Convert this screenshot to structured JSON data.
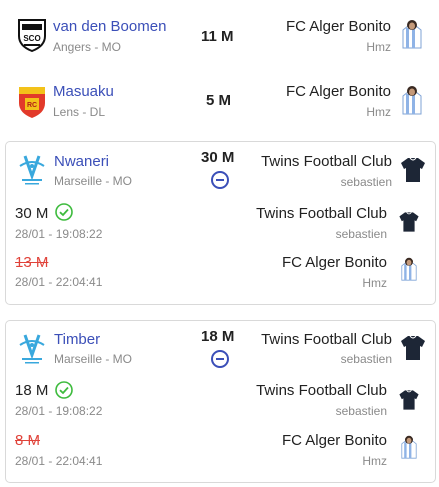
{
  "transfers": [
    {
      "player": "van den Boomen",
      "club_position": "Angers - MO",
      "club_logo": "angers-sco-logo",
      "price": "11 M",
      "team": "FC Alger Bonito",
      "manager": "Hmz",
      "avatar": "striped-jersey-avatar"
    },
    {
      "player": "Masuaku",
      "club_position": "Lens - DL",
      "club_logo": "rc-lens-logo",
      "price": "5 M",
      "team": "FC Alger Bonito",
      "manager": "Hmz",
      "avatar": "striped-jersey-avatar"
    }
  ],
  "auctions": [
    {
      "player": "Nwaneri",
      "club_position": "Marseille - MO",
      "club_logo": "om-marseille-logo",
      "price": "30 M",
      "winner_team": "Twins Football Club",
      "winner_manager": "sebastien",
      "bids": [
        {
          "amount": "30 M",
          "time": "28/01 - 19:08:22",
          "team": "Twins Football Club",
          "manager": "sebastien",
          "status": "accepted"
        },
        {
          "amount": "13 M",
          "time": "28/01 - 22:04:41",
          "team": "FC Alger Bonito",
          "manager": "Hmz",
          "status": "outbid"
        }
      ]
    },
    {
      "player": "Timber",
      "club_position": "Marseille - MO",
      "club_logo": "om-marseille-logo",
      "price": "18 M",
      "winner_team": "Twins Football Club",
      "winner_manager": "sebastien",
      "bids": [
        {
          "amount": "18 M",
          "time": "28/01 - 19:08:22",
          "team": "Twins Football Club",
          "manager": "sebastien",
          "status": "accepted"
        },
        {
          "amount": "8 M",
          "time": "28/01 - 22:04:41",
          "team": "FC Alger Bonito",
          "manager": "Hmz",
          "status": "outbid"
        }
      ]
    }
  ],
  "colors": {
    "accent": "#3b4fb8",
    "success": "#3dbb3d",
    "outbid": "#e0433a",
    "muted": "#8a8a8a"
  }
}
